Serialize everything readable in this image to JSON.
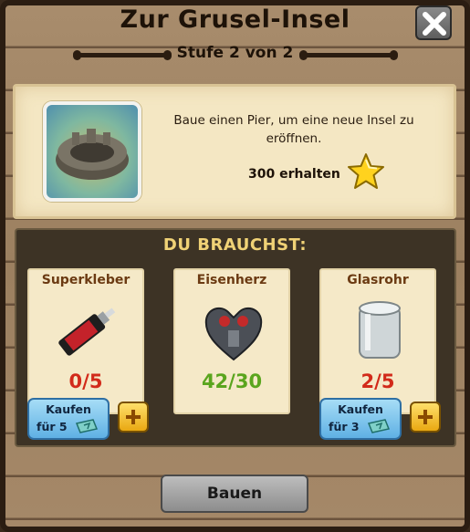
{
  "header": {
    "title": "Zur Grusel-Insel",
    "subtitle": "Stufe 2 von 2"
  },
  "quest": {
    "description": "Baue einen Pier, um eine neue Insel zu eröffnen.",
    "reward_text": "300 erhalten",
    "reward_icon": "star-icon"
  },
  "needs": {
    "title": "DU BRAUCHST:",
    "items": [
      {
        "name": "Superkleber",
        "count": "0/5",
        "status": "incomplete",
        "buy_label": "Kaufen",
        "buy_price": "für 5"
      },
      {
        "name": "Eisenherz",
        "count": "42/30",
        "status": "complete"
      },
      {
        "name": "Glasrohr",
        "count": "2/5",
        "status": "incomplete",
        "buy_label": "Kaufen",
        "buy_price": "für 3"
      }
    ]
  },
  "actions": {
    "build_label": "Bauen"
  },
  "colors": {
    "incomplete": "#d22a1a",
    "complete": "#5aa51e",
    "accent": "#f0d276"
  }
}
